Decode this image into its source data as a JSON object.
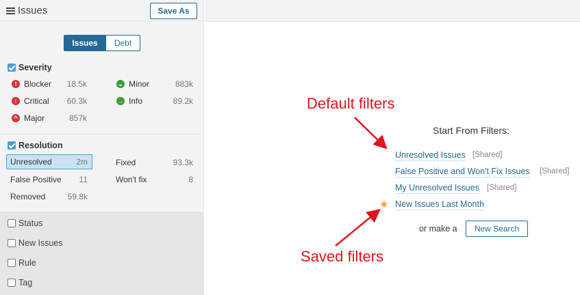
{
  "sidebar": {
    "title": "Issues",
    "save_as_label": "Save As",
    "mode_toggle": {
      "issues_label": "Issues",
      "debt_label": "Debt"
    },
    "severity": {
      "title": "Severity",
      "checked": true,
      "items": [
        {
          "label": "Blocker",
          "count": "18.5k",
          "icon": "blocker-icon"
        },
        {
          "label": "Minor",
          "count": "883k",
          "icon": "minor-icon"
        },
        {
          "label": "Critical",
          "count": "60.3k",
          "icon": "critical-icon"
        },
        {
          "label": "Info",
          "count": "89.2k",
          "icon": "info-icon"
        },
        {
          "label": "Major",
          "count": "857k",
          "icon": "major-icon"
        }
      ]
    },
    "resolution": {
      "title": "Resolution",
      "checked": true,
      "items": [
        {
          "label": "Unresolved",
          "count": "2m",
          "selected": true
        },
        {
          "label": "Fixed",
          "count": "93.3k"
        },
        {
          "label": "False Positive",
          "count": "11"
        },
        {
          "label": "Won't fix",
          "count": "8"
        },
        {
          "label": "Removed",
          "count": "59.8k"
        }
      ]
    },
    "collapsed_facets": [
      "Status",
      "New Issues",
      "Rule",
      "Tag"
    ]
  },
  "main": {
    "start_title": "Start From Filters:",
    "filters": [
      {
        "label": "Unresolved Issues",
        "tag": "[Shared]"
      },
      {
        "label": "False Positive and Won't Fix Issues",
        "tag": "[Shared]"
      },
      {
        "label": "My Unresolved Issues",
        "tag": "[Shared]"
      },
      {
        "label": "New Issues Last Month",
        "tag": ""
      }
    ],
    "or_make": "or make a",
    "new_search_label": "New Search",
    "annotations": {
      "default": "Default filters",
      "saved": "Saved filters"
    }
  },
  "colors": {
    "accent": "#236a97",
    "annotation": "#e0141e",
    "star": "#f4a123",
    "severity_red": "#d4333f",
    "severity_green": "#3c9c3c"
  }
}
